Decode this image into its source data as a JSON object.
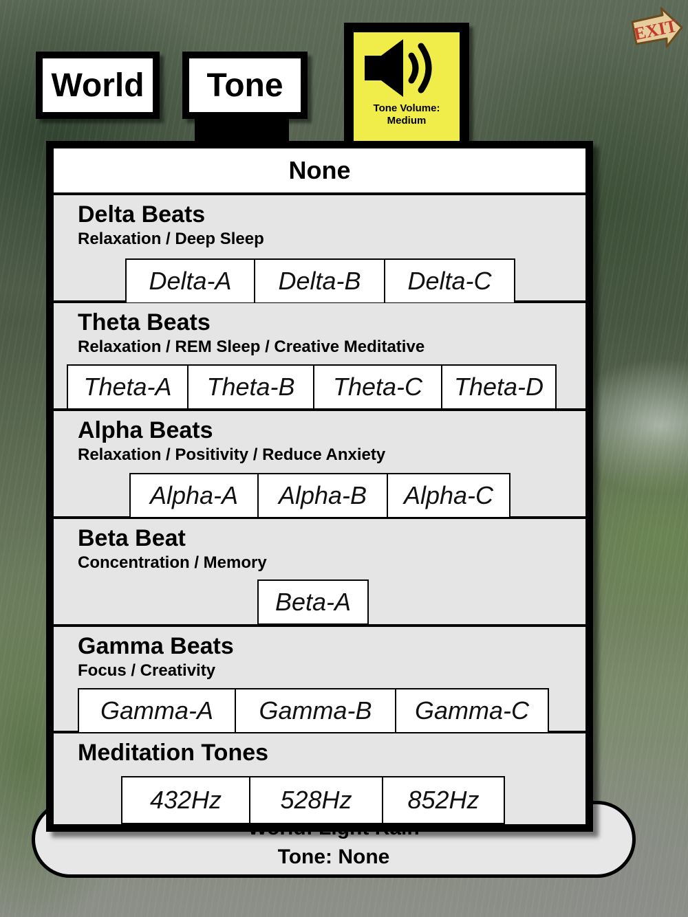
{
  "tabs": {
    "world": "World",
    "tone": "Tone"
  },
  "volume": {
    "label_line1": "Tone Volume:",
    "label_line2": "Medium"
  },
  "exit": {
    "label": "EXIT"
  },
  "none_option": "None",
  "sections": [
    {
      "title": "Delta Beats",
      "subtitle": "Relaxation / Deep Sleep",
      "buttons": [
        "Delta-A",
        "Delta-B",
        "Delta-C"
      ]
    },
    {
      "title": "Theta Beats",
      "subtitle": "Relaxation / REM Sleep / Creative Meditative",
      "buttons": [
        "Theta-A",
        "Theta-B",
        "Theta-C",
        "Theta-D"
      ]
    },
    {
      "title": "Alpha Beats",
      "subtitle": "Relaxation / Positivity / Reduce Anxiety",
      "buttons": [
        "Alpha-A",
        "Alpha-B",
        "Alpha-C"
      ]
    },
    {
      "title": "Beta Beat",
      "subtitle": "Concentration / Memory",
      "buttons": [
        "Beta-A"
      ]
    },
    {
      "title": "Gamma Beats",
      "subtitle": "Focus / Creativity",
      "buttons": [
        "Gamma-A",
        "Gamma-B",
        "Gamma-C"
      ]
    },
    {
      "title": "Meditation Tones",
      "subtitle": "",
      "buttons": [
        "432Hz",
        "528Hz",
        "852Hz"
      ]
    }
  ],
  "status": {
    "world": "World: Light Rain",
    "tone": "Tone: None"
  },
  "colors": {
    "volume_bg": "#f0ec4a",
    "panel_bg": "#e5e5e5",
    "exit_bg": "#e8cfa0",
    "exit_text": "#c0392b"
  }
}
